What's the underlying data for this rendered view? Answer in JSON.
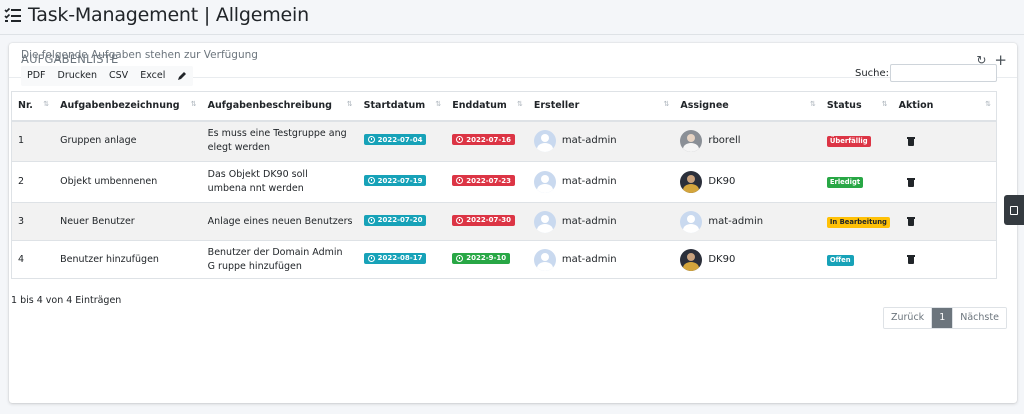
{
  "page": {
    "title": "Task-Management | Allgemein"
  },
  "card": {
    "title": "AUFGABENLISTE",
    "refresh_icon": "↻",
    "add_icon": "+"
  },
  "info_text": "Die folgende Aufgaben stehen zur Verfügung",
  "export_buttons": [
    "PDF",
    "Drucken",
    "CSV",
    "Excel"
  ],
  "search": {
    "label": "Suche:",
    "value": ""
  },
  "table": {
    "columns": [
      "Nr.",
      "Aufgabenbezeichnung",
      "Aufgabenbeschreibung",
      "Startdatum",
      "Enddatum",
      "Ersteller",
      "Assignee",
      "Status",
      "Aktion"
    ],
    "rows": [
      {
        "nr": "1",
        "name": "Gruppen anlage",
        "desc": "Es muss eine Testgruppe ang elegt werden",
        "start": "2022-07-04",
        "end": "2022-07-16",
        "creator": "mat-admin",
        "assignee": "rborell",
        "status": "Überfällig",
        "status_color": "#dc3545"
      },
      {
        "nr": "2",
        "name": "Objekt umbennenen",
        "desc": "Das Objekt DK90 soll umbena nnt werden",
        "start": "2022-07-19",
        "end": "2022-07-23",
        "creator": "mat-admin",
        "assignee": "DK90",
        "status": "Erledigt",
        "status_color": "#28a745"
      },
      {
        "nr": "3",
        "name": "Neuer Benutzer",
        "desc": "Anlage eines neuen Benutzers",
        "start": "2022-07-20",
        "end": "2022-07-30",
        "creator": "mat-admin",
        "assignee": "mat-admin",
        "status": "In Bearbeitung",
        "status_color": "#ffc107"
      },
      {
        "nr": "4",
        "name": "Benutzer hinzufügen",
        "desc": "Benutzer der Domain Admin G ruppe hinzufügen",
        "start": "2022-08-17",
        "end": "2022-9-10",
        "creator": "mat-admin",
        "assignee": "DK90",
        "status": "Offen",
        "status_color": "#17a2b8"
      }
    ]
  },
  "colors": {
    "start_badge": "#17a2b8",
    "end_badge": "#dc3545",
    "end_badge_ok": "#28a745"
  },
  "footer": {
    "info": "1 bis 4 von 4 Einträgen"
  },
  "pagination": {
    "prev": "Zurück",
    "current": "1",
    "next": "Nächste"
  }
}
